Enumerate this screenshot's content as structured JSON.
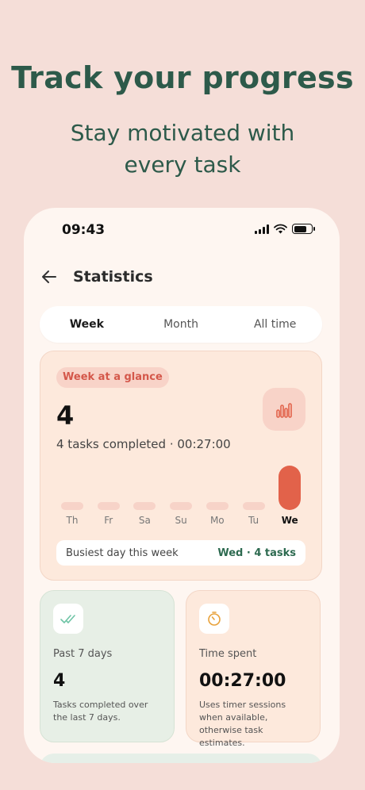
{
  "promo": {
    "headline": "Track your progress",
    "subhead": "Stay motivated with every task"
  },
  "status_bar": {
    "time": "09:43"
  },
  "nav": {
    "title": "Statistics"
  },
  "tabs": [
    {
      "label": "Week",
      "active": true
    },
    {
      "label": "Month",
      "active": false
    },
    {
      "label": "All time",
      "active": false
    }
  ],
  "glance": {
    "pill": "Week at a glance",
    "count": "4",
    "summary": "4 tasks completed · 00:27:00",
    "days": [
      {
        "label": "Th",
        "value": 0,
        "today": false
      },
      {
        "label": "Fr",
        "value": 0,
        "today": false
      },
      {
        "label": "Sa",
        "value": 0,
        "today": false
      },
      {
        "label": "Su",
        "value": 0,
        "today": false
      },
      {
        "label": "Mo",
        "value": 0,
        "today": false
      },
      {
        "label": "Tu",
        "value": 0,
        "today": false
      },
      {
        "label": "We",
        "value": 4,
        "today": true
      }
    ],
    "busiest_label": "Busiest day this week",
    "busiest_value": "Wed · 4 tasks"
  },
  "cards": {
    "past": {
      "label": "Past 7 days",
      "value": "4",
      "desc": "Tasks completed over the last 7 days.",
      "icon": "double-check-icon"
    },
    "time": {
      "label": "Time spent",
      "value": "00:27:00",
      "desc": "Uses timer sessions when available, otherwise task estimates.",
      "icon": "timer-icon"
    }
  },
  "colors": {
    "accent": "#e2624a",
    "brand_green": "#2d5a4a",
    "background": "#f5ded8"
  }
}
